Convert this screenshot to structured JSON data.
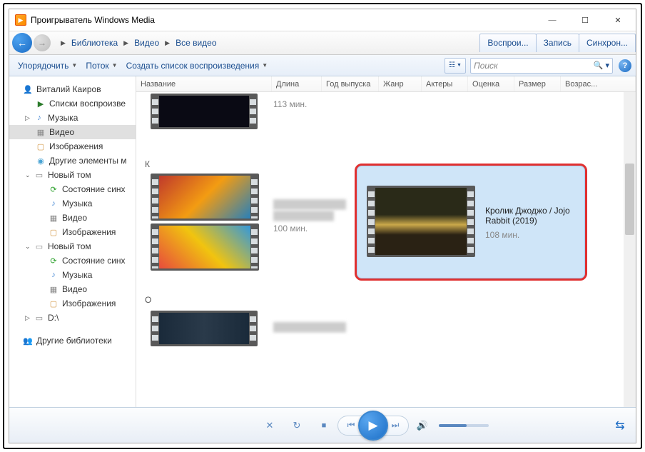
{
  "titlebar": {
    "title": "Проигрыватель Windows Media"
  },
  "breadcrumb": [
    "Библиотека",
    "Видео",
    "Все видео"
  ],
  "nav_tabs": [
    "Воспрои...",
    "Запись",
    "Синхрон..."
  ],
  "toolbar": {
    "organize": "Упорядочить",
    "stream": "Поток",
    "create_playlist": "Создать список воспроизведения",
    "search_placeholder": "Поиск"
  },
  "columns": [
    "Название",
    "Длина",
    "Год выпуска",
    "Жанр",
    "Актеры",
    "Оценка",
    "Размер",
    "Возрас..."
  ],
  "sidebar": {
    "user": "Виталий Каиров",
    "playlists": "Списки воспроизве",
    "music": "Музыка",
    "video": "Видео",
    "images": "Изображения",
    "other": "Другие элементы м",
    "drive1": "Новый том",
    "drive2": "Новый том",
    "drive3": "D:\\",
    "sync": "Состояние синх",
    "sub_music": "Музыка",
    "sub_video": "Видео",
    "sub_images": "Изображения",
    "other_libs": "Другие библиотеки"
  },
  "items": {
    "top_duration": "113 мин.",
    "group_k": "К",
    "group_o": "О",
    "k_duration": "100 мин.",
    "selected_title": "Кролик Джоджо / Jojo Rabbit (2019)",
    "selected_duration": "108 мин."
  }
}
